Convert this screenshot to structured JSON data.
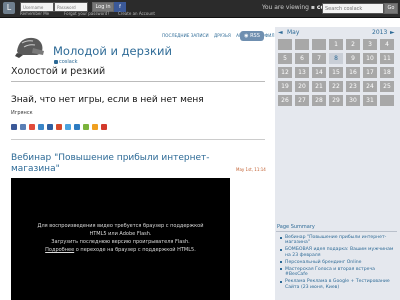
{
  "topbar": {
    "logo": "L",
    "username_placeholder": "Username",
    "password_placeholder": "Password",
    "login_label": "Log in",
    "facebook_label": "f",
    "remember_me": "Remember Me",
    "forgot_password": "Forgot your password?",
    "create_account": "Create an Account",
    "viewing_prefix": "You are viewing",
    "viewing_user": "coslack",
    "search_placeholder": "Search coslack",
    "go_label": "Go"
  },
  "header": {
    "blog_title": "Молодой и дерзкий",
    "username": "coslack",
    "nav": [
      "ПОСЛЕДНИЕ ЗАПИСИ",
      "ДРУЗЬЯ",
      "АРХИВ",
      "ПРОФИЛЬ"
    ],
    "rss": "RSS",
    "subtitle": "Холостой и резкий"
  },
  "quote": {
    "text": "Знай, что нет игры, если в ней нет меня",
    "author": "Игрянск"
  },
  "share_colors": [
    "#3b5998",
    "#5a7fb5",
    "#e14b3b",
    "#3a86c8",
    "#2f5fa0",
    "#d64a2a",
    "#4ca3dd",
    "#2d7bc1",
    "#7bb33b",
    "#f0a020",
    "#d33a2c"
  ],
  "post": {
    "title": "Вебинар \"Повышение прибыли интернет-магазина\"",
    "date": "May 1st, 11:14",
    "video_line1": "Для воспроизведения видео требуется браузер с поддержкой",
    "video_line2": "HTML5 или Adobe Flash.",
    "video_line3": "Загрузить последнюю версию проигрывателя Flash.",
    "video_link": "Подробнее",
    "video_line4_rest": " о переходе на браузер с поддержкой HTML5."
  },
  "calendar": {
    "prev": "◄",
    "month": "May",
    "year": "2013",
    "next": "►",
    "weeks": [
      [
        "",
        "",
        "",
        "1",
        "2",
        "3",
        "4"
      ],
      [
        "5",
        "6",
        "7",
        "8",
        "9",
        "10",
        "11"
      ],
      [
        "12",
        "13",
        "14",
        "15",
        "16",
        "17",
        "18"
      ],
      [
        "19",
        "20",
        "21",
        "22",
        "23",
        "24",
        "25"
      ],
      [
        "26",
        "27",
        "28",
        "29",
        "30",
        "31",
        ""
      ]
    ]
  },
  "page_summary": {
    "heading": "Page Summary",
    "items": [
      "Вебинар \"Повышение прибыли интернет-магазина\"",
      "БОМБОВАЯ идея подарка: Вашим мужчинам на 23 февраля",
      "Персональный брендинг Online",
      "Мастерская Голоса и вторая встреча #BesCafe",
      "Реклама Реклама в Google + Тестирование Сайта (23 июня, Киев)"
    ]
  }
}
